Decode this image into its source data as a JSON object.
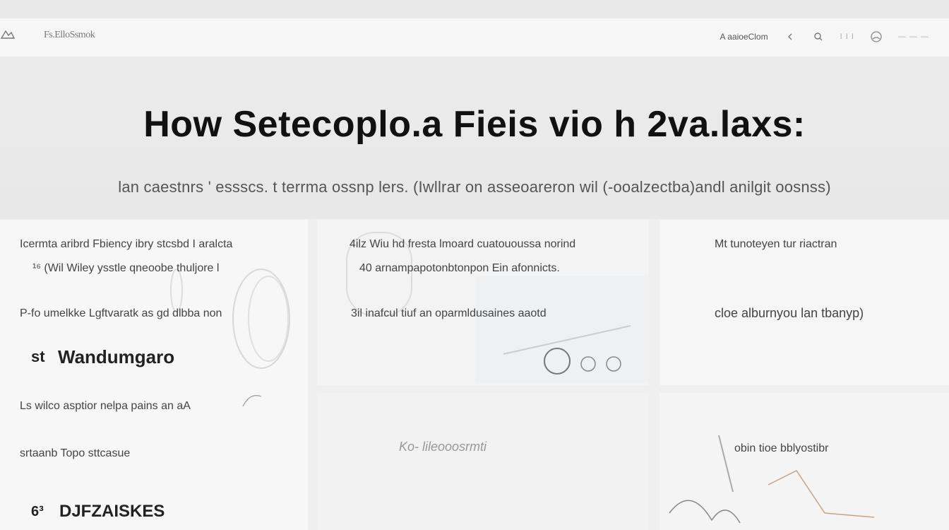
{
  "nav": {
    "brand": "Fs.ElloSsmok",
    "link_signin": "A aaioeClom",
    "faint_items": "I I I",
    "faint_right": "— — —"
  },
  "hero": {
    "title": "How Setecoplo.a Fieis vio h 2va.laxs:",
    "subtitle": "lan caestnrs  ' essscs.   t terrma ossnp lers.  (Iwllrar on asseoareron wil (-ooalzectba)andl anilgit oosnss)"
  },
  "card_a": {
    "line1": "Icermta aribrd Fbiency ibry stcsbd I aralcta",
    "line2": "¹⁶  (Wil Wiley ysstle qneoobe thuljore l",
    "line3": "P-fo umelkke  Lgftvaratk  as gd  dlbba non",
    "heading1_num": "st",
    "heading1": "Wandumgaro",
    "line4": "Ls  wilco asptior nelpa pains  an aA",
    "line5": "srtaanb Topo sttcasue",
    "heading2_num": "6³",
    "heading2": "DJFZAISKES"
  },
  "card_b": {
    "line1": "4ilz Wiu hd fresta lmoard cuatououssa norind",
    "line2": "40  arnampapotonbtonpon Ein afonnicts.",
    "line3": "3il  inafcul tiuf an oparmldusaines aaotd"
  },
  "card_c": {
    "line1": "Mt tunoteyen  tur riactran",
    "line2": "cloe alburnyou lan tbanyp)"
  },
  "card_d": {
    "line1": "Ko- lileooosrmti"
  },
  "card_e": {
    "line1": "obin tioe  bblyostibr"
  }
}
